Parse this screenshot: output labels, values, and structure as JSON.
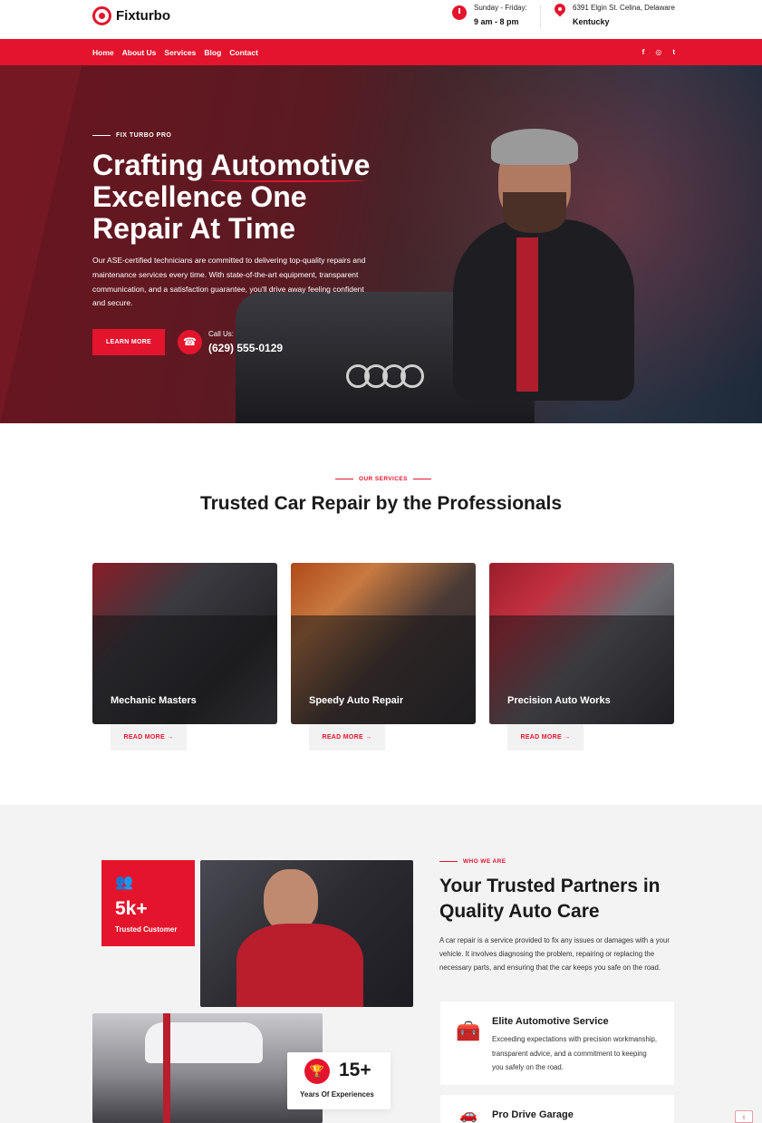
{
  "brand": {
    "name": "Fixturbo",
    "accent": "#e4142d"
  },
  "header": {
    "hours_label": "Sunday - Friday:",
    "hours_value": "9 am - 8 pm",
    "address_label": "6391 Elgin St. Celina, Delaware",
    "address_value": "Kentucky"
  },
  "nav": {
    "items": [
      "Home",
      "About Us",
      "Services",
      "Blog",
      "Contact"
    ],
    "social": [
      "f",
      "◎",
      "t"
    ]
  },
  "hero": {
    "tagline": "FIX TURBO PRO",
    "title": "Crafting Automotive Excellence One Repair At Time",
    "text": "Our ASE-certified technicians are committed to delivering top-quality repairs and maintenance services every time. With state-of-the-art equipment, transparent communication, and a satisfaction guarantee, you'll drive away feeling confident and secure.",
    "button": "LEARN MORE",
    "call_label": "Call Us:",
    "call_number": "(629) 555-0129"
  },
  "services": {
    "tag": "OUR SERVICES",
    "title": "Trusted Car Repair by the Professionals",
    "cards": [
      {
        "title": "Mechanic Masters",
        "link": "READ MORE →"
      },
      {
        "title": "Speedy Auto Repair",
        "link": "READ MORE →"
      },
      {
        "title": "Precision Auto Works",
        "link": "READ MORE →"
      }
    ]
  },
  "about": {
    "stat_number": "5k+",
    "stat_label": "Trusted Customer",
    "exp_number": "15+",
    "exp_label": "Years Of Experiences",
    "tag": "WHO WE ARE",
    "title": "Your Trusted Partners in Quality Auto Care",
    "text": "A car repair is a service provided to fix any issues or damages with a your vehicle. It involves diagnosing the problem, repairing or replacing the necessary parts, and ensuring that the car keeps you safe on the road.",
    "features": [
      {
        "title": "Elite Automotive Service",
        "text": "Exceeding expectations with precision workmanship, transparent advice, and a commitment to keeping you safely on the road."
      },
      {
        "title": "Pro Drive Garage",
        "text": ""
      }
    ]
  },
  "scroll_top": "↑"
}
